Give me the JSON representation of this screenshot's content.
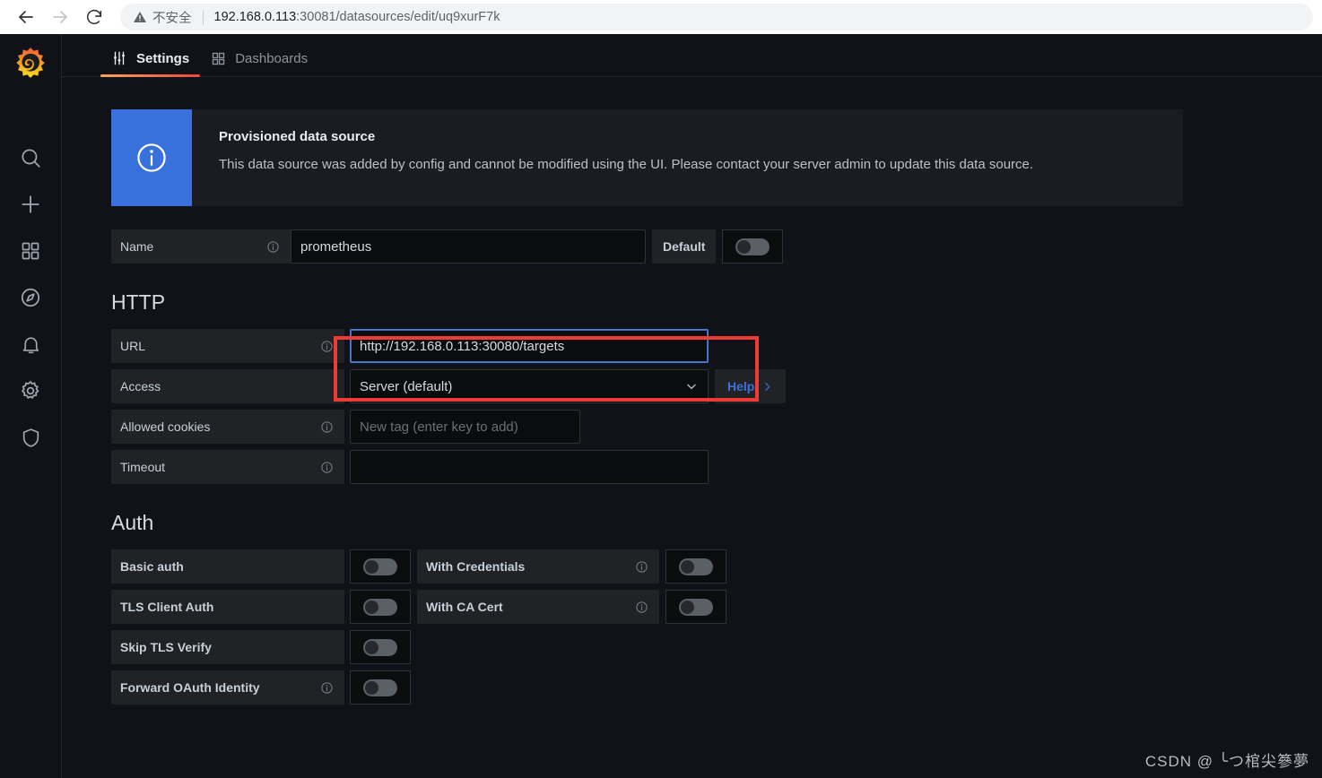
{
  "browser": {
    "back_icon": "arrow-left-icon",
    "forward_icon": "arrow-right-icon",
    "reload_icon": "reload-icon",
    "security_icon": "warning-triangle-icon",
    "security_label": "不安全",
    "url_host": "192.168.0.113",
    "url_rest": ":30081/datasources/edit/uq9xurF7k"
  },
  "sidebar": {
    "logo": "grafana-logo-icon",
    "items": [
      {
        "icon": "search-icon",
        "name": "search"
      },
      {
        "icon": "plus-icon",
        "name": "create"
      },
      {
        "icon": "dashboards-grid-icon",
        "name": "dashboards"
      },
      {
        "icon": "compass-icon",
        "name": "explore"
      },
      {
        "icon": "bell-icon",
        "name": "alerting"
      },
      {
        "icon": "gear-icon",
        "name": "configuration"
      },
      {
        "icon": "shield-icon",
        "name": "server-admin"
      }
    ]
  },
  "tabs": [
    {
      "label": "Settings",
      "icon": "sliders-icon",
      "active": true
    },
    {
      "label": "Dashboards",
      "icon": "grid-icon",
      "active": false
    }
  ],
  "banner": {
    "icon": "info-circle-icon",
    "title": "Provisioned data source",
    "text": "This data source was added by config and cannot be modified using the UI. Please contact your server admin to update this data source.",
    "accent_color": "#3871dc"
  },
  "name_row": {
    "label": "Name",
    "info_icon": "info-circle-icon",
    "value": "prometheus",
    "default_label": "Default",
    "default_toggle": "off"
  },
  "http_section": {
    "title": "HTTP",
    "url": {
      "label": "URL",
      "info_icon": "info-circle-icon",
      "value": "http://192.168.0.113:30080/targets",
      "focused": true,
      "highlight_color": "#ef3b35"
    },
    "access": {
      "label": "Access",
      "value": "Server (default)",
      "chevron_icon": "chevron-down-icon",
      "help_label": "Help",
      "help_chevron_icon": "chevron-right-icon"
    },
    "allowed_cookies": {
      "label": "Allowed cookies",
      "info_icon": "info-circle-icon",
      "placeholder": "New tag (enter key to add)",
      "value": ""
    },
    "timeout": {
      "label": "Timeout",
      "info_icon": "info-circle-icon",
      "value": ""
    }
  },
  "auth_section": {
    "title": "Auth",
    "left": [
      {
        "label": "Basic auth",
        "toggle": "off",
        "info": false
      },
      {
        "label": "TLS Client Auth",
        "toggle": "off",
        "info": false
      },
      {
        "label": "Skip TLS Verify",
        "toggle": "off",
        "info": false
      },
      {
        "label": "Forward OAuth Identity",
        "toggle": "off",
        "info": true
      }
    ],
    "right": [
      {
        "label": "With Credentials",
        "toggle": "off",
        "info": true
      },
      {
        "label": "With CA Cert",
        "toggle": "off",
        "info": true
      }
    ]
  },
  "watermark": "CSDN @ ╰つ棺尖篸夢"
}
